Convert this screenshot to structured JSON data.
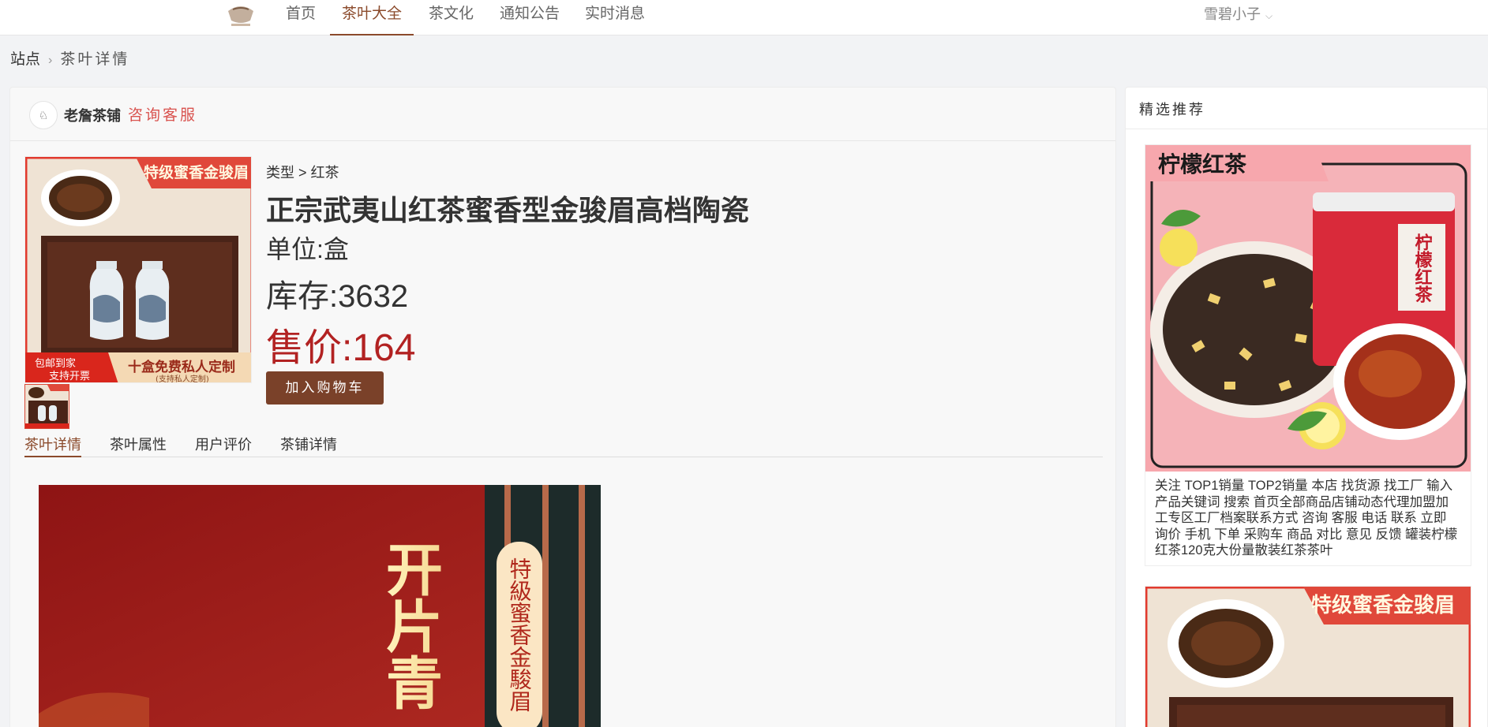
{
  "nav": {
    "items": [
      "首页",
      "茶叶大全",
      "茶文化",
      "通知公告",
      "实时消息"
    ],
    "active_index": 1,
    "user": "雪碧小子"
  },
  "breadcrumb": {
    "root": "站点",
    "current": "茶叶详情"
  },
  "shop": {
    "name": "老詹茶铺",
    "service": "咨询客服"
  },
  "product": {
    "type_path": "类型 > 红茶",
    "title": "正宗武夷山红茶蜜香型金骏眉高档陶瓷",
    "unit": "单位:盒",
    "stock": "库存:3632",
    "price": "售价:164",
    "cart_button": "加入购物车",
    "image_banner": "特级蜜香金骏眉",
    "image_promo": "十盒免费私人定制",
    "image_promo_sub": "(支持私人定制)",
    "image_badge_1": "包邮到家",
    "image_badge_2": "支持开票"
  },
  "tabs": [
    "茶叶详情",
    "茶叶属性",
    "用户评价",
    "茶铺详情"
  ],
  "detail_image": {
    "text_1": "开片青",
    "text_2": "特級蜜香金駿眉"
  },
  "side": {
    "title": "精选推荐",
    "rec1": {
      "banner": "柠檬红茶",
      "jar_label": "柠檬红茶",
      "desc": "关注 TOP1销量 TOP2销量 本店 找货源 找工厂 输入产品关键词 搜索 首页全部商品店铺动态代理加盟加工专区工厂档案联系方式 咨询 客服 电话 联系 立即 询价 手机 下单 采购车 商品 对比 意见 反馈 罐装柠檬红茶120克大份量散装红茶茶叶"
    },
    "rec2": {
      "banner": "特级蜜香金骏眉"
    }
  },
  "colors": {
    "accent": "#8b4a2b",
    "button": "#7a4129",
    "price": "#b22222",
    "service": "#d9534f"
  }
}
